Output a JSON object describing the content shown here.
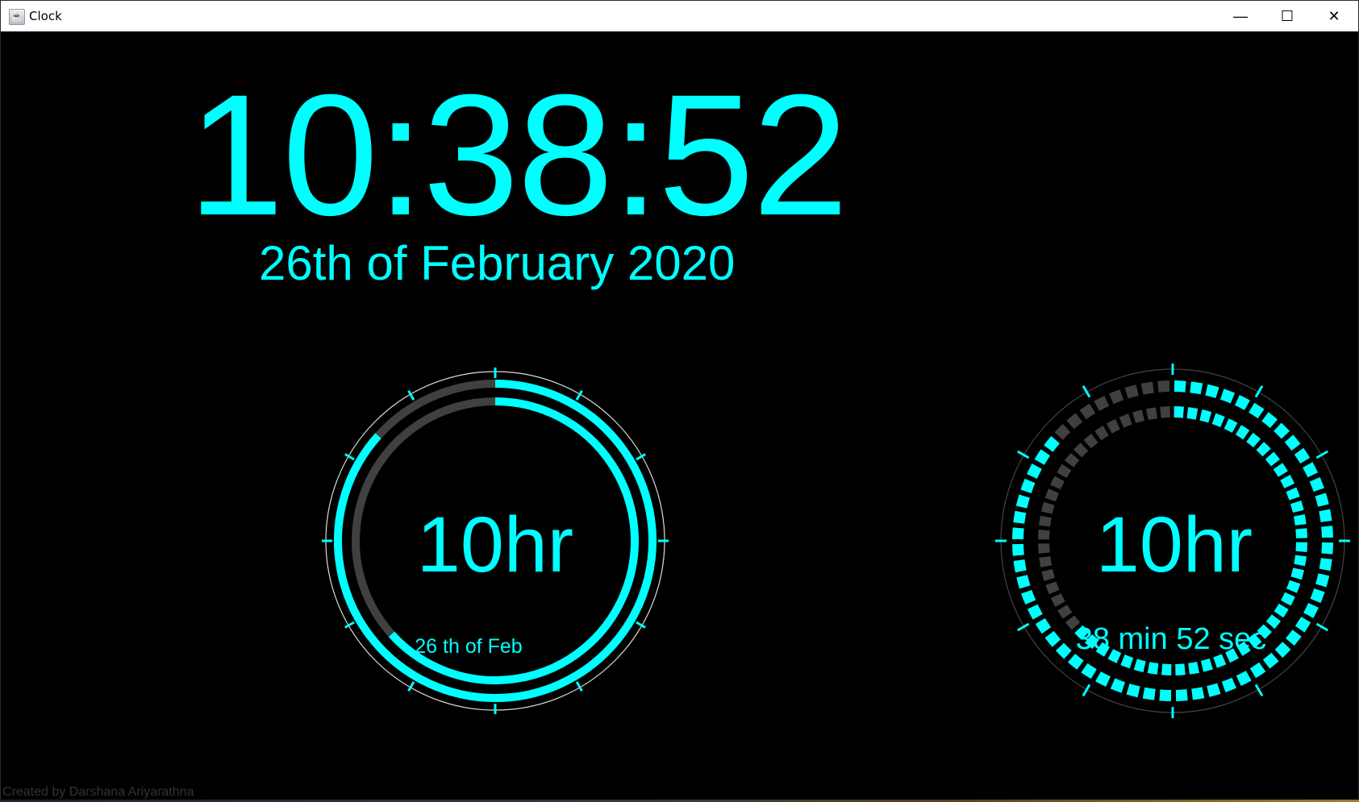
{
  "window": {
    "title": "Clock",
    "minimize_icon": "minimize-icon",
    "maximize_icon": "maximize-icon",
    "close_icon": "close-icon"
  },
  "main": {
    "time": "10:38:52",
    "date": "26th of February 2020"
  },
  "clock_left": {
    "hour_label": "10hr",
    "date_label": "26 th of Feb",
    "minutes": 38,
    "seconds": 52
  },
  "clock_right": {
    "hour_label": "10hr",
    "sub_label": "38 min 52 sec",
    "minutes": 38,
    "seconds": 52,
    "segments": 60
  },
  "footer": {
    "credit": "Created by Darshana Ariyarathna"
  },
  "colors": {
    "accent": "#00ffff",
    "track": "#404040",
    "background": "#000000"
  }
}
